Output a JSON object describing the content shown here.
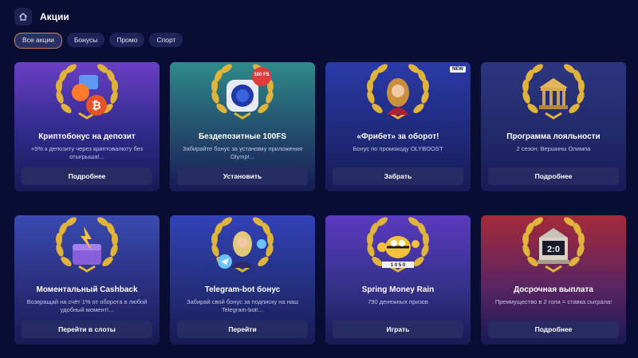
{
  "header": {
    "title": "Акции",
    "home_icon": "home-icon"
  },
  "filters": [
    {
      "label": "Все акции",
      "active": true
    },
    {
      "label": "Бонусы",
      "active": false
    },
    {
      "label": "Промо",
      "active": false
    },
    {
      "label": "Спорт",
      "active": false
    }
  ],
  "cards": [
    {
      "title": "Криптобонус на депозит",
      "description": "+5% к депозиту через криптовалюту без отыгрыша!...",
      "button": "Подробнее",
      "art": "crypto-coins-icon"
    },
    {
      "title": "Бездепозитные 100FS",
      "description": "Забирайте бонус за установку приложения Olymp!...",
      "button": "Установить",
      "art": "app-badge-icon",
      "art_badge": "100 FS"
    },
    {
      "title": "«Фрибет» за оборот!",
      "description": "Бонус по промокоду OLYBOOST",
      "button": "Забрать",
      "art": "woman-icon",
      "badge": "NEW"
    },
    {
      "title": "Программа лояльности",
      "description": "2 сезон: Вершины Олимпа",
      "button": "Подробнее",
      "art": "temple-icon"
    },
    {
      "title": "Моментальный Cashback",
      "description": "Возвращай на счёт 1% от оборота в любой удобный момент!...",
      "button": "Перейти в слоты",
      "art": "wallet-icon"
    },
    {
      "title": "Telegram-bot бонус",
      "description": "Забирай свой бонус за подписку на наш Telegram-bot!...",
      "button": "Перейти",
      "art": "telegram-icon"
    },
    {
      "title": "Spring Money Rain",
      "description": "790 денежных призов",
      "button": "Играть",
      "art": "bee-icon",
      "art_badge": "1 0 5 0"
    },
    {
      "title": "Досрочная выплата",
      "description": "Преимущество в 2 гола = ставка сыграла!",
      "button": "Подробнее",
      "art": "scoreboard-icon",
      "art_badge": "2:0"
    }
  ]
}
